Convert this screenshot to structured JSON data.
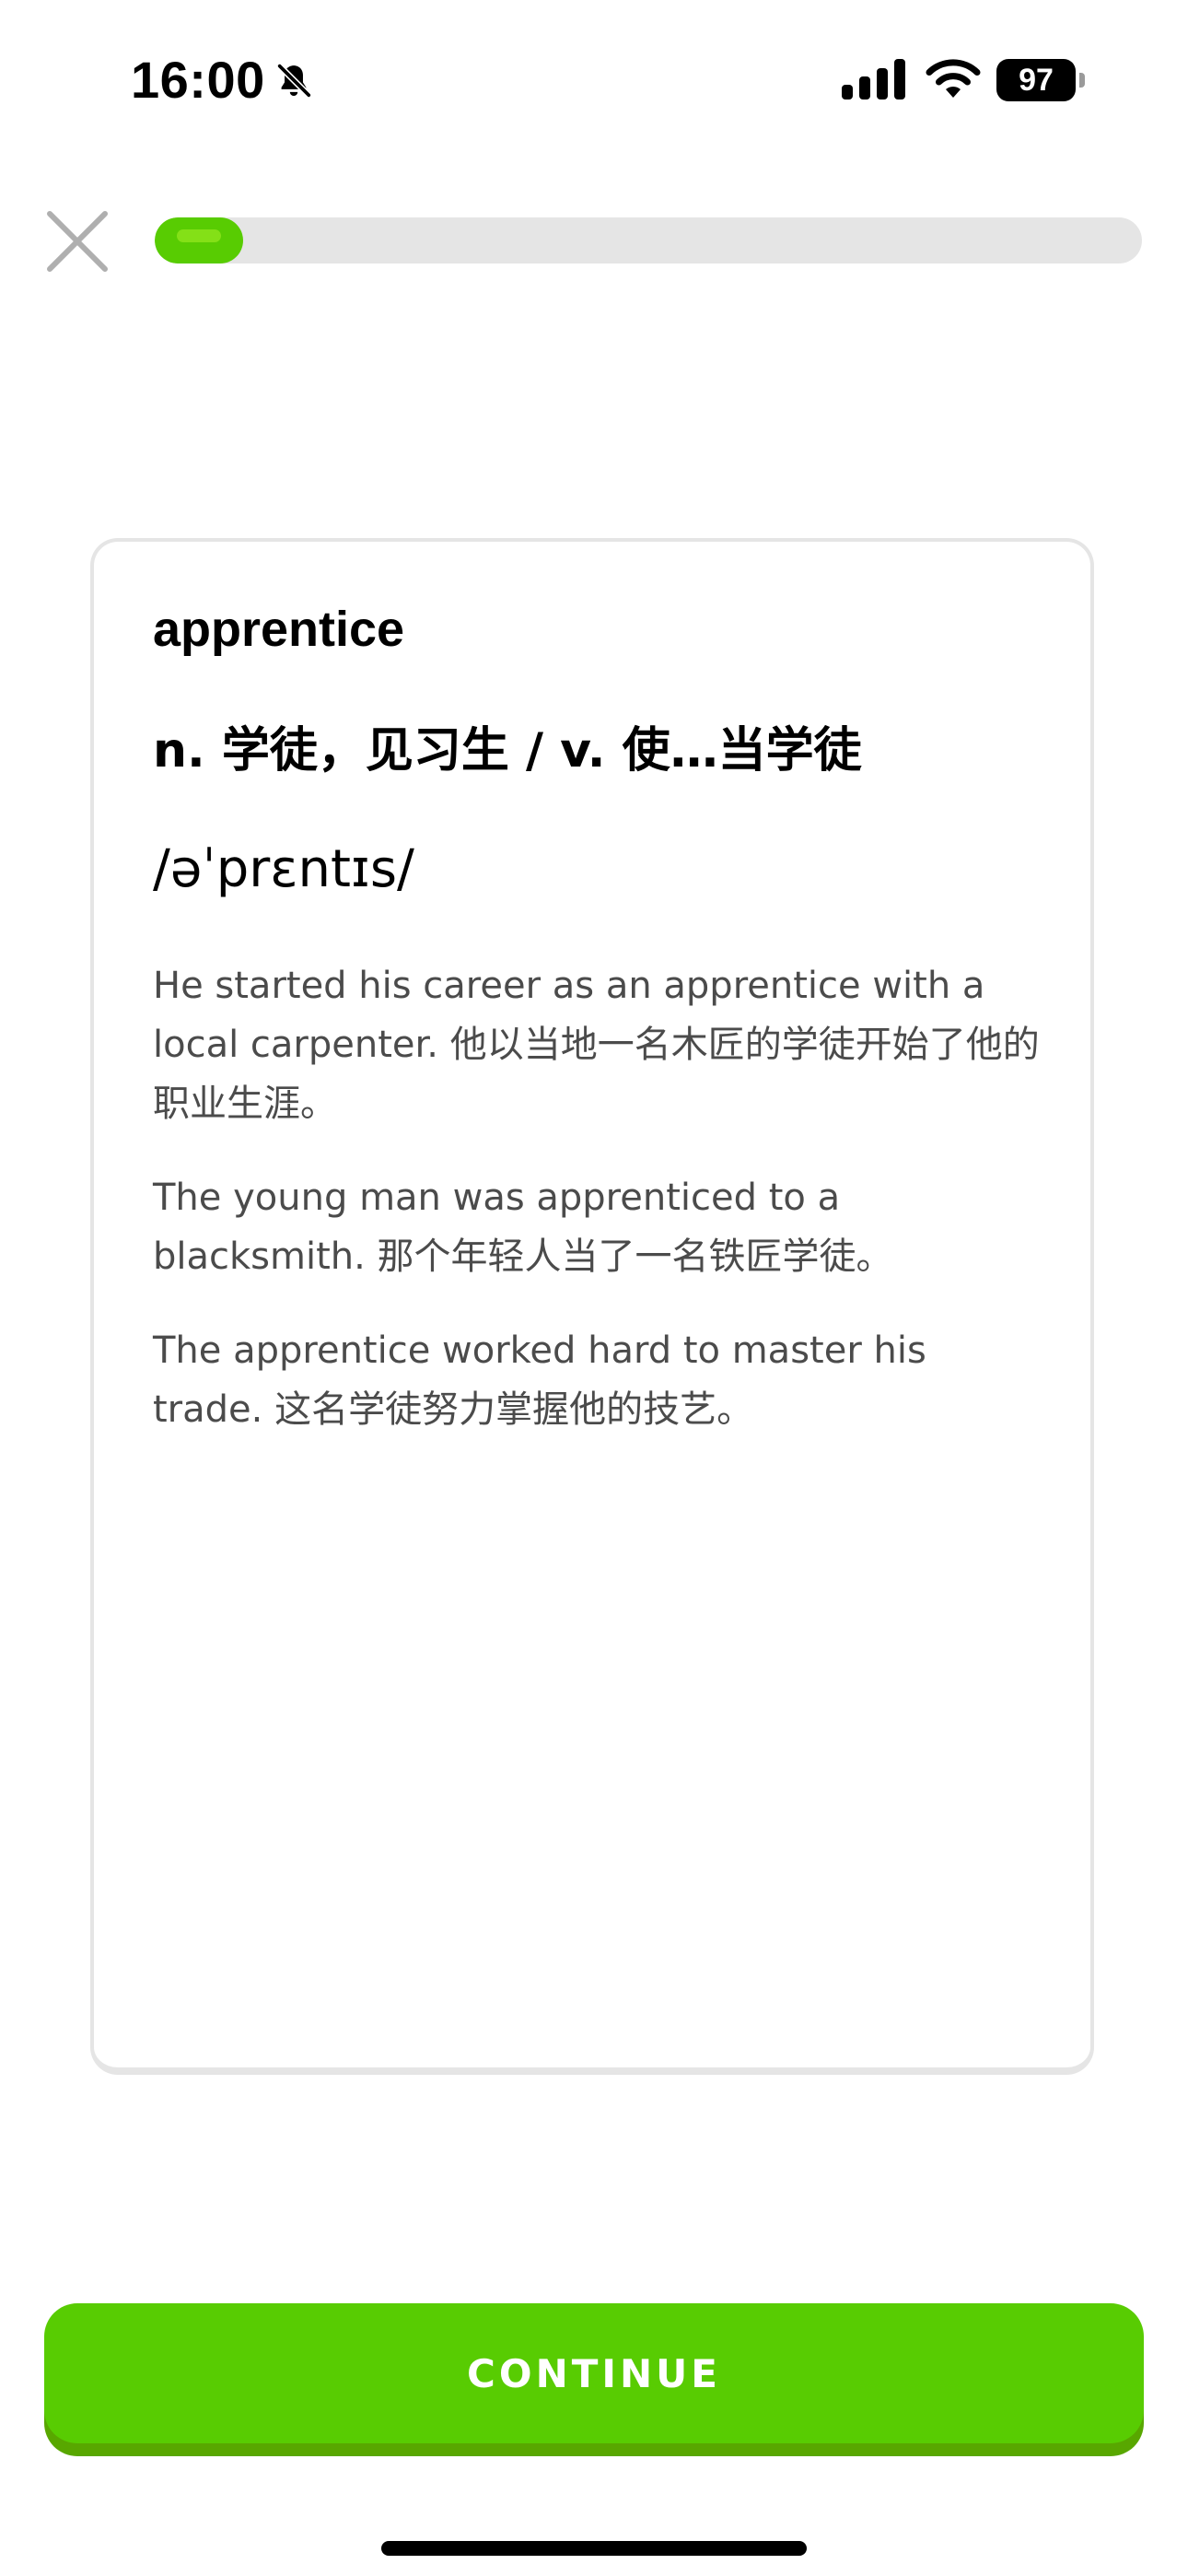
{
  "status_bar": {
    "time": "16:00",
    "battery_level": "97",
    "icons": [
      "bell-slash-icon",
      "signal-icon",
      "wifi-icon",
      "battery-icon"
    ]
  },
  "lesson": {
    "progress_fraction": 0.09,
    "close_icon": "close-icon"
  },
  "card": {
    "word": "apprentice",
    "definition": "n. 学徒，见习生 / v. 使…当学徒",
    "phonetic": "/əˈprɛntɪs/",
    "examples": [
      "He started his career as an apprentice with a local carpenter. 他以当地一名木匠的学徒开始了他的职业生涯。",
      "The young man was apprenticed to a blacksmith. 那个年轻人当了一名铁匠学徒。",
      "The apprentice worked hard to master his trade. 这名学徒努力掌握他的技艺。"
    ]
  },
  "footer": {
    "continue_label": "CONTINUE"
  },
  "colors": {
    "accent": "#58cc02",
    "accent_shadow": "#58a700",
    "track": "#e5e5e5",
    "card_border": "#e5e5e5",
    "body_text": "#4b4b4b"
  }
}
